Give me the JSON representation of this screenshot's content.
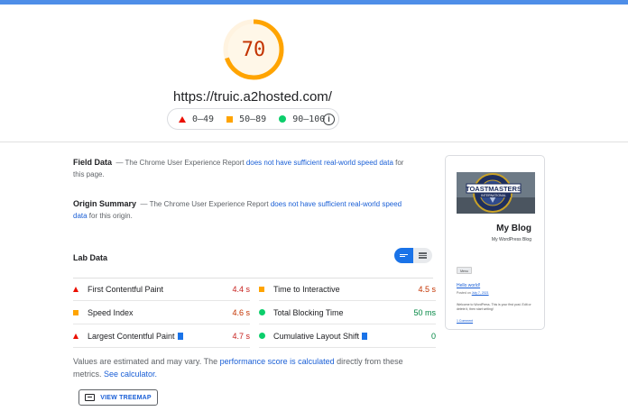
{
  "score": {
    "value": "70",
    "fraction": 0.7,
    "color": "#ffa400",
    "text_color": "#c33300"
  },
  "url": "https://truic.a2hosted.com/",
  "legend": {
    "fail": "0–49",
    "average": "50–89",
    "pass": "90–100",
    "info_icon": "i"
  },
  "field_data": {
    "title": "Field Data",
    "prefix": "— The Chrome User Experience Report ",
    "link": "does not have sufficient real-world speed data",
    "suffix": " for",
    "line2": "this page."
  },
  "origin_summary": {
    "title": "Origin Summary",
    "prefix": "— The Chrome User Experience Report ",
    "link1": "does not have sufficient real-world speed",
    "link2": "data",
    "suffix": " for this origin."
  },
  "lab_data": {
    "title": "Lab Data",
    "metrics": [
      {
        "label": "First Contentful Paint",
        "value": "4.4 s",
        "status": "fail",
        "flag": false
      },
      {
        "label": "Time to Interactive",
        "value": "4.5 s",
        "status": "average",
        "flag": false
      },
      {
        "label": "Speed Index",
        "value": "4.6 s",
        "status": "average",
        "flag": false
      },
      {
        "label": "Total Blocking Time",
        "value": "50 ms",
        "status": "pass",
        "flag": false
      },
      {
        "label": "Largest Contentful Paint",
        "value": "4.7 s",
        "status": "fail",
        "flag": true
      },
      {
        "label": "Cumulative Layout Shift",
        "value": "0",
        "status": "pass",
        "flag": true
      }
    ]
  },
  "footnote": {
    "part1": "Values are estimated and may vary. The ",
    "link1": "performance score is calculated",
    "part2": " directly from these metrics. ",
    "link2": "See calculator."
  },
  "treemap_button": "VIEW TREEMAP",
  "thumbnail": {
    "logo_text": "TOASTMASTERS",
    "logo_subtext": "INTERNATIONAL",
    "blog_title": "My Blog",
    "blog_subtitle": "My WordPress Blog",
    "menu": "Menu",
    "post_title": "Hello world!",
    "post_meta_prefix": "Posted on ",
    "post_meta_date": "July 7, 2021",
    "post_body": "Welcome to WordPress. This is your first post. Edit or delete it, then start writing!",
    "comment": "1 Comment"
  },
  "colors": {
    "fail": "#eb0f00",
    "average": "#ffa400",
    "pass": "#0cce6b",
    "fail_text": "#c7221f",
    "average_text": "#c33300",
    "pass_text": "#018642",
    "link": "#1a5fd6"
  }
}
